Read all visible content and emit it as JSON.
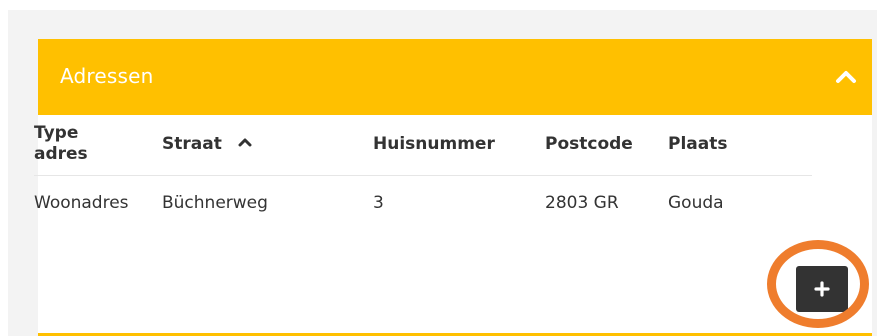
{
  "panel": {
    "title": "Adressen"
  },
  "table": {
    "headers": {
      "type_adres": "Type adres",
      "straat": "Straat",
      "huisnummer": "Huisnummer",
      "postcode": "Postcode",
      "plaats": "Plaats"
    },
    "sort_column": "straat",
    "sort_direction": "ascending",
    "rows": [
      {
        "type_adres": "Woonadres",
        "straat": "Büchnerweg",
        "huisnummer": "3",
        "postcode": "2803 GR",
        "plaats": "Gouda"
      }
    ]
  },
  "colors": {
    "header_bg": "#ffc000",
    "header_text": "#ffffff",
    "add_button_bg": "#333333",
    "highlight_ring": "#ef7d2d"
  },
  "icons": {
    "collapse": "chevron-up-icon",
    "sort": "chevron-up-icon",
    "add": "plus-icon"
  }
}
